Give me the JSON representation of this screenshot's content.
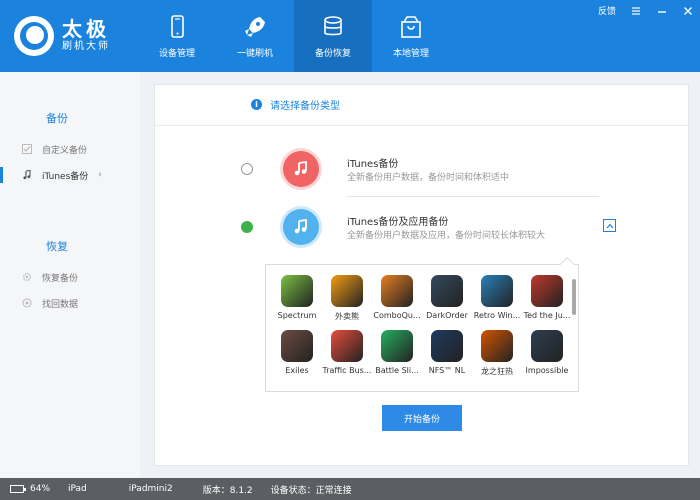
{
  "header": {
    "logo_title": "太极",
    "logo_sub": "刷机大师",
    "nav": [
      {
        "label": "设备管理",
        "icon": "phone-icon",
        "active": false
      },
      {
        "label": "一键刷机",
        "icon": "rocket-icon",
        "active": false
      },
      {
        "label": "备份恢复",
        "icon": "database-icon",
        "active": true
      },
      {
        "label": "本地管理",
        "icon": "shopping-bag-icon",
        "active": false
      }
    ],
    "feedback": "反馈"
  },
  "sidebar": {
    "backup_title": "备份",
    "backup_items": [
      {
        "label": "自定义备份",
        "icon": "checkbox-icon"
      },
      {
        "label": "iTunes备份",
        "icon": "music-note-icon",
        "active": true
      }
    ],
    "restore_title": "恢复",
    "restore_items": [
      {
        "label": "恢复备份",
        "icon": "gear-icon"
      },
      {
        "label": "找回数据",
        "icon": "target-icon"
      }
    ]
  },
  "main": {
    "title": "请选择备份类型",
    "options": [
      {
        "name": "iTunes备份",
        "desc": "全新备份用户数据，备份时间和体积适中",
        "checked": false
      },
      {
        "name": "iTunes备份及应用备份",
        "desc": "全新备份用户数据及应用，备份时间较长体积较大",
        "checked": true
      }
    ],
    "apps": [
      {
        "label": "Spectrum",
        "color": "#7bc043"
      },
      {
        "label": "外卖熊",
        "color": "#f39c12"
      },
      {
        "label": "ComboQu...",
        "color": "#e67e22"
      },
      {
        "label": "DarkOrder",
        "color": "#34495e"
      },
      {
        "label": "Retro Win...",
        "color": "#2980b9"
      },
      {
        "label": "Ted the Ju...",
        "color": "#c0392b"
      },
      {
        "label": "Exiles",
        "color": "#6d4c41"
      },
      {
        "label": "Traffic Bus...",
        "color": "#e74c3c"
      },
      {
        "label": "Battle Sli...",
        "color": "#27ae60"
      },
      {
        "label": "NFS™ NL",
        "color": "#1f3a5f"
      },
      {
        "label": "龙之狂热",
        "color": "#d35400"
      },
      {
        "label": "Impossible",
        "color": "#2c3e50"
      }
    ],
    "start_button": "开始备份"
  },
  "status": {
    "battery": "64%",
    "battery_level": 0.64,
    "device_type": "iPad",
    "device_name": "iPadmini2",
    "version": "版本：8.1.2",
    "state": "设备状态：正常连接"
  },
  "colors": {
    "accent": "#1b83de",
    "check": "#3db24b",
    "itunes_red": "#f06463",
    "itunes_blue": "#52b2ee"
  }
}
